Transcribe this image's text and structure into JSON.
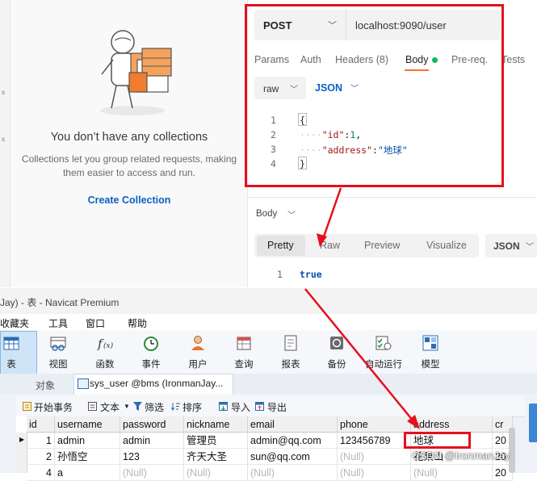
{
  "postman": {
    "empty_state": {
      "title": "You don’t have any collections",
      "description": "Collections let you group related requests, making them easier to access and run.",
      "create_link": "Create Collection"
    },
    "request": {
      "method": "POST",
      "url": "localhost:9090/user",
      "tabs": [
        "Params",
        "Auth",
        "Headers (8)",
        "Body",
        "Pre-req.",
        "Tests"
      ],
      "active_tab": "Body",
      "body_mode": "raw",
      "body_format": "JSON",
      "line_numbers": [
        "1",
        "2",
        "3",
        "4"
      ],
      "body_lines": [
        "{",
        "\"id\":1,",
        "\"address\":\"地球\"",
        "}"
      ],
      "body_keys": {
        "id": "\"id\"",
        "id_value": "1",
        "address": "\"address\"",
        "address_value": "\"地球\""
      }
    },
    "response": {
      "section_label": "Body",
      "view_tabs": [
        "Pretty",
        "Raw",
        "Preview",
        "Visualize"
      ],
      "active_view": "Pretty",
      "format": "JSON",
      "line_number": "1",
      "value": "true"
    }
  },
  "navicat": {
    "window_title": "Jay) - 表 - Navicat Premium",
    "menu": [
      "收藏夹",
      "工具",
      "窗口",
      "帮助"
    ],
    "ribbon": [
      {
        "label": "表",
        "icon": "table-icon"
      },
      {
        "label": "视图",
        "icon": "view-icon"
      },
      {
        "label": "函数",
        "icon": "function-icon"
      },
      {
        "label": "事件",
        "icon": "event-clock-icon"
      },
      {
        "label": "用户",
        "icon": "user-icon"
      },
      {
        "label": "查询",
        "icon": "query-icon"
      },
      {
        "label": "报表",
        "icon": "report-icon"
      },
      {
        "label": "备份",
        "icon": "backup-icon"
      },
      {
        "label": "自动运行",
        "icon": "automation-icon"
      },
      {
        "label": "模型",
        "icon": "model-icon"
      }
    ],
    "tabs": {
      "objects": "对象",
      "table_tab": "sys_user @bms (IronmanJay..."
    },
    "toolbar": [
      "开始事务",
      "文本",
      "筛选",
      "排序",
      "导入",
      "导出"
    ],
    "columns": [
      "id",
      "username",
      "password",
      "nickname",
      "email",
      "phone",
      "address",
      "cr"
    ],
    "rows": [
      [
        "1",
        "admin",
        "admin",
        "管理员",
        "admin@qq.com",
        "123456789",
        "地球",
        "20"
      ],
      [
        "2",
        "孙悟空",
        "123",
        "齐天大圣",
        "sun@qq.com",
        "(Null)",
        "花果山",
        "20"
      ],
      [
        "4",
        "a",
        "(Null)",
        "(Null)",
        "(Null)",
        "(Null)",
        "(Null)",
        "20"
      ]
    ]
  },
  "watermark": "CSDN @IronmanJay",
  "colors": {
    "annotation_red": "#e5101d",
    "postman_orange": "#ff6c37",
    "link_blue": "#0b5fc3",
    "status_green": "#0cbb52"
  }
}
